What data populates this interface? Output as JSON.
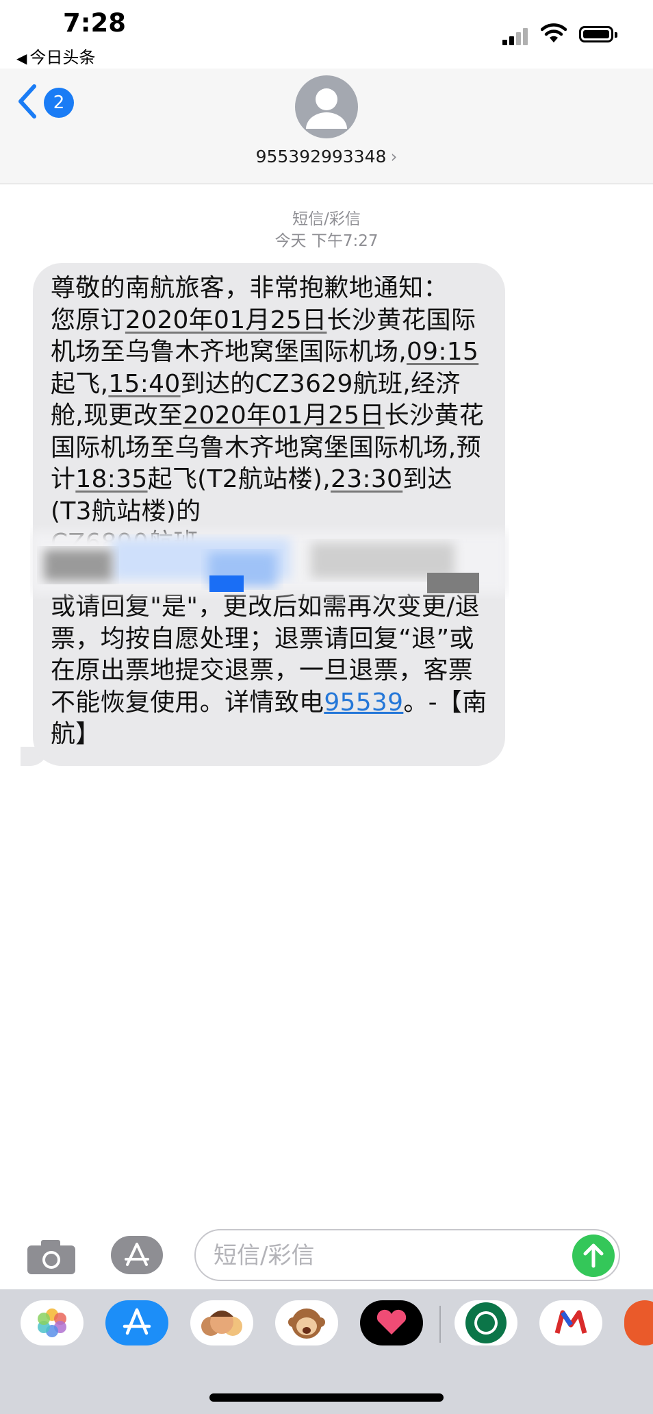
{
  "status_bar": {
    "time": "7:28",
    "back_app": "今日头条"
  },
  "header": {
    "unread_count": "2",
    "contact_number": "955392993348",
    "chevron": "›"
  },
  "thread": {
    "message_type": "短信/彩信",
    "timestamp": "今天 下午7:27"
  },
  "message": {
    "p1": "尊敬的南航旅客，非常抱歉地通知：\n您原订",
    "d1": "2020年01月25日",
    "p2": "长沙黄花国际机场至乌鲁木齐地窝堡国际机场,",
    "t1": "09:15",
    "p3": "起飞,",
    "t2": "15:40",
    "p4": "到达的CZ3629航班,经济舱,现更改至",
    "d2": "2020年01月25日",
    "p5": "长沙黄花国际机场至乌鲁木齐地窝堡国际机场,预计",
    "t3": "18:35",
    "p6": "起飞(T2航站楼),",
    "t4": "23:30",
    "p7": "到达(T3航站楼)的\nCZ6890航班\n\n或请回复\"是\"，更改后如需再次变更/退票，均按自愿处理；退票请回复“退”或在原出票地提交退票，一旦退票，客票不能恢复使用。详情致电",
    "phone": "95539",
    "p8": "。-【南航】"
  },
  "composer": {
    "placeholder": "短信/彩信"
  },
  "app_tray": {
    "apps": [
      "photos-app",
      "app-store-app",
      "memoji-app",
      "animoji-app",
      "digital-touch-app",
      "starbucks-app",
      "airline-app",
      "partial-app"
    ]
  },
  "colors": {
    "accent": "#1a7cf5",
    "bubble": "#e9e9eb",
    "send": "#34c759",
    "link": "#2477d8"
  }
}
